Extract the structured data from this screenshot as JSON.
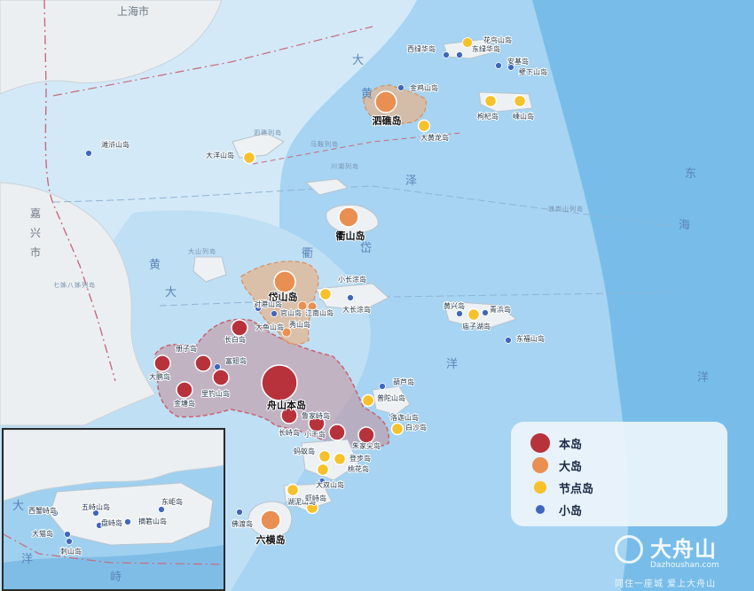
{
  "map": {
    "land_labels": [
      "上海市",
      "嘉兴市",
      "山"
    ],
    "sea_labels": [
      "大",
      "黄",
      "东",
      "海",
      "洋",
      "岱",
      "衢",
      "黄",
      "大",
      "泽",
      "洋"
    ],
    "strait_labels": [
      "泗礁列岛",
      "川湖列岛",
      "浪岗山列岛",
      "七姊八姊列岛",
      "大山列岛",
      "马鞍列岛"
    ],
    "islands": [
      {
        "name": "舟山本岛",
        "category": "本岛",
        "main": true
      },
      {
        "name": "长白岛",
        "category": "本岛"
      },
      {
        "name": "册子岛",
        "category": "本岛"
      },
      {
        "name": "大鹏岛",
        "category": "本岛"
      },
      {
        "name": "富翅岛",
        "category": "小岛"
      },
      {
        "name": "里钓山岛",
        "category": "本岛"
      },
      {
        "name": "金塘岛",
        "category": "本岛"
      },
      {
        "name": "长峙岛",
        "category": "本岛"
      },
      {
        "name": "鲁家峙岛",
        "category": "本岛"
      },
      {
        "name": "小干岛",
        "category": "本岛"
      },
      {
        "name": "朱家尖岛",
        "category": "本岛"
      },
      {
        "name": "岱山岛",
        "category": "大岛",
        "main": true
      },
      {
        "name": "泗礁岛",
        "category": "大岛",
        "main": true
      },
      {
        "name": "衢山岛",
        "category": "大岛",
        "main": true
      },
      {
        "name": "六横岛",
        "category": "大岛",
        "main": true
      },
      {
        "name": "秀山岛",
        "category": "大岛"
      },
      {
        "name": "官山岛",
        "category": "大岛"
      },
      {
        "name": "江南山岛",
        "category": "大岛"
      },
      {
        "name": "金鸡山岛",
        "category": "小岛"
      },
      {
        "name": "花鸟山岛",
        "category": "节点岛"
      },
      {
        "name": "西绿华岛",
        "category": "小岛"
      },
      {
        "name": "东绿华岛",
        "category": "小岛"
      },
      {
        "name": "壁下山岛",
        "category": "小岛"
      },
      {
        "name": "安基岛",
        "category": "小岛"
      },
      {
        "name": "枸杞岛",
        "category": "节点岛"
      },
      {
        "name": "嵊山岛",
        "category": "节点岛"
      },
      {
        "name": "大黄龙岛",
        "category": "节点岛"
      },
      {
        "name": "大洋山岛",
        "category": "节点岛"
      },
      {
        "name": "滩浒山岛",
        "category": "小岛"
      },
      {
        "name": "小长涂岛",
        "category": "节点岛"
      },
      {
        "name": "大长涂岛",
        "category": "小岛"
      },
      {
        "name": "对港山岛",
        "category": "小岛"
      },
      {
        "name": "大鱼山岛",
        "category": "小岛"
      },
      {
        "name": "黄兴岛",
        "category": "小岛"
      },
      {
        "name": "庙子湖岛",
        "category": "节点岛"
      },
      {
        "name": "青浜岛",
        "category": "小岛"
      },
      {
        "name": "东福山岛",
        "category": "小岛"
      },
      {
        "name": "葫芦岛",
        "category": "小岛"
      },
      {
        "name": "普陀山岛",
        "category": "节点岛"
      },
      {
        "name": "洛迦山岛",
        "category": "小岛"
      },
      {
        "name": "白沙岛",
        "category": "节点岛"
      },
      {
        "name": "登步岛",
        "category": "节点岛"
      },
      {
        "name": "蚂蚁岛",
        "category": "节点岛"
      },
      {
        "name": "桃花岛",
        "category": "节点岛"
      },
      {
        "name": "大双山岛",
        "category": "小岛"
      },
      {
        "name": "湖泥山岛",
        "category": "节点岛"
      },
      {
        "name": "虾峙岛",
        "category": "节点岛"
      },
      {
        "name": "佛渡岛",
        "category": "小岛"
      }
    ]
  },
  "inset": {
    "islands": [
      "西蟹峙岛",
      "大猫岛",
      "五峙山岛",
      "盘峙岛",
      "摘箬山岛",
      "东岠岛",
      "刺山岛"
    ],
    "sea_labels": [
      "大",
      "洋",
      "峙"
    ]
  },
  "legend": {
    "items": [
      {
        "label": "本岛",
        "color": "#b8323b"
      },
      {
        "label": "大岛",
        "color": "#e98f52"
      },
      {
        "label": "节点岛",
        "color": "#f6c12a"
      },
      {
        "label": "小岛",
        "color": "#3e66bd"
      }
    ]
  },
  "watermark": {
    "title": "大舟山",
    "domain": "Dazhoushan.com",
    "slogan": "同住一座城 爱上大舟山"
  }
}
